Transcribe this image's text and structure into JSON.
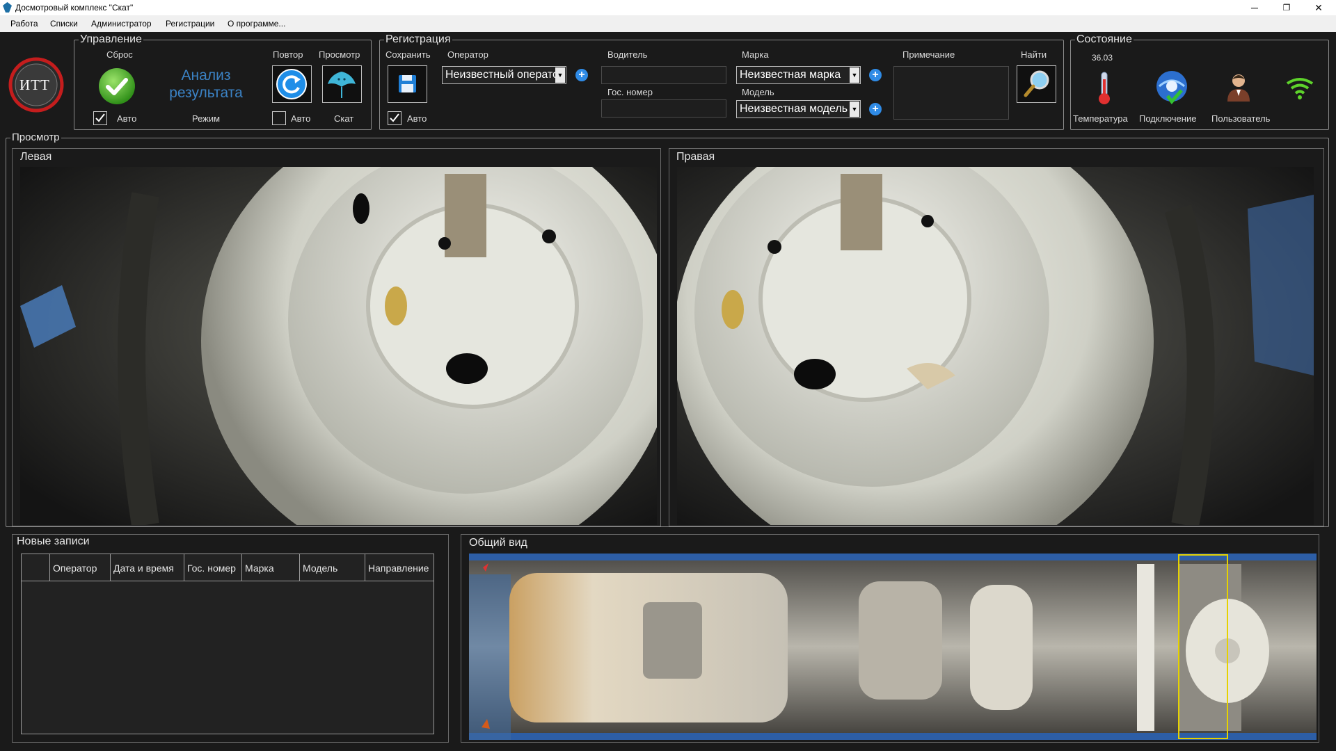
{
  "window": {
    "title": "Досмотровый комплекс \"Скат\"",
    "minimize": "─",
    "maximize": "❐",
    "close": "✕"
  },
  "menu": [
    "Работа",
    "Списки",
    "Администратор",
    "Регистрации",
    "О программе..."
  ],
  "logo": {
    "text": "ИТТ"
  },
  "control": {
    "title": "Управление",
    "reset_label": "Сброс",
    "reset_auto_label": "Авто",
    "reset_auto_checked": true,
    "analysis_label": "Анализ результата",
    "mode_label": "Режим",
    "repeat_label": "Повтор",
    "repeat_auto_label": "Авто",
    "repeat_auto_checked": false,
    "view_label": "Просмотр",
    "skat_label": "Скат"
  },
  "registration": {
    "title": "Регистрация",
    "save_label": "Сохранить",
    "save_auto_label": "Авто",
    "save_auto_checked": true,
    "operator_label": "Оператор",
    "operator_value": "Неизвестный оператор",
    "driver_label": "Водитель",
    "driver_value": "",
    "plate_label": "Гос. номер",
    "plate_value": "",
    "brand_label": "Марка",
    "brand_value": "Неизвестная марка",
    "model_label": "Модель",
    "model_value": "Неизвестная модель",
    "note_label": "Примечание",
    "note_value": "",
    "find_label": "Найти"
  },
  "state": {
    "title": "Состояние",
    "temperature_value": "36.03",
    "temperature_label": "Температура",
    "connection_label": "Подключение",
    "user_label": "Пользователь"
  },
  "view": {
    "title": "Просмотр",
    "left_title": "Левая",
    "right_title": "Правая"
  },
  "new_records": {
    "title": "Новые записи",
    "columns": [
      "",
      "Оператор",
      "Дата и время",
      "Гос. номер",
      "Марка",
      "Модель",
      "Направление"
    ]
  },
  "overview": {
    "title": "Общий вид"
  },
  "colors": {
    "accent_blue": "#2f8be6",
    "analysis_text": "#3b82c4",
    "marker_yellow": "#e6d200"
  }
}
